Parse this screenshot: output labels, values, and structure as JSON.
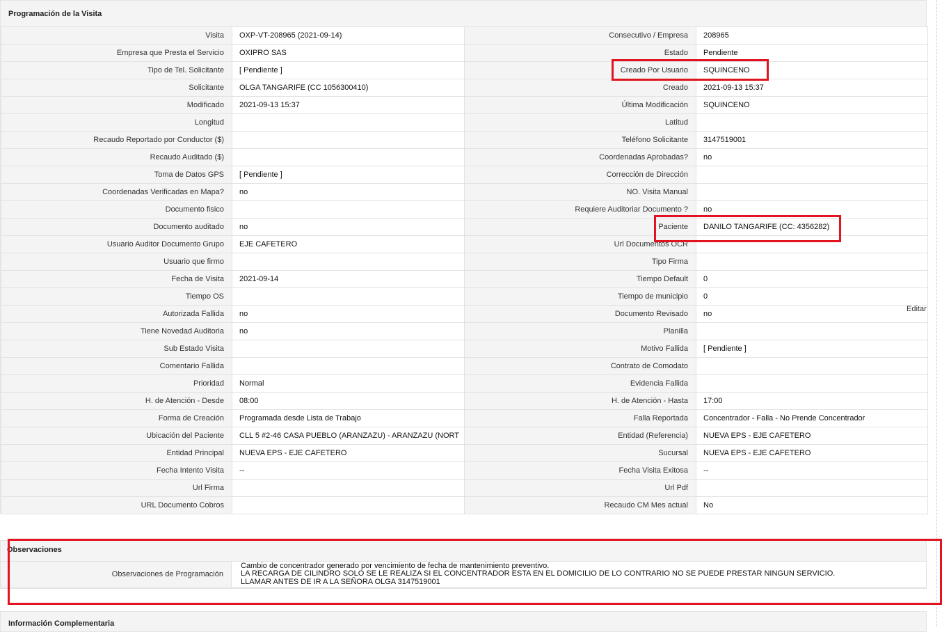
{
  "sections": {
    "programacion": "Programación de la Visita",
    "observaciones": "Observaciones",
    "complementaria": "Información Complementaria"
  },
  "rows": [
    {
      "l1": "Visita",
      "v1": "OXP-VT-208965 (2021-09-14)",
      "l2": "Consecutivo / Empresa",
      "v2": "208965"
    },
    {
      "l1": "Empresa que Presta el Servicio",
      "v1": "OXIPRO SAS",
      "l2": "Estado",
      "v2": "Pendiente"
    },
    {
      "l1": "Tipo de Tel. Solicitante",
      "v1": "[ Pendiente ]",
      "l2": "Creado Por Usuario",
      "v2": "SQUINCENO"
    },
    {
      "l1": "Solicitante",
      "v1": "OLGA TANGARIFE (CC 1056300410)",
      "l2": "Creado",
      "v2": "2021-09-13 15:37"
    },
    {
      "l1": "Modificado",
      "v1": "2021-09-13 15:37",
      "l2": "Última Modificación",
      "v2": " SQUINCENO"
    },
    {
      "l1": "Longitud",
      "v1": "",
      "l2": "Latitud",
      "v2": ""
    },
    {
      "l1": "Recaudo Reportado por Conductor ($)",
      "v1": "",
      "l2": "Teléfono Solicitante",
      "v2": "3147519001"
    },
    {
      "l1": "Recaudo Auditado ($)",
      "v1": "",
      "l2": "Coordenadas Aprobadas?",
      "v2": " no"
    },
    {
      "l1": "Toma de Datos GPS",
      "v1": "[ Pendiente ]",
      "l2": "Corrección de Dirección",
      "v2": ""
    },
    {
      "l1": "Coordenadas Verificadas en Mapa?",
      "v1": " no",
      "l2": "NO. Visita Manual",
      "v2": ""
    },
    {
      "l1": "Documento fisico",
      "v1": "",
      "l2": "Requiere Auditoriar Documento ?",
      "v2": " no"
    },
    {
      "l1": "Documento auditado",
      "v1": " no",
      "l2": "Paciente",
      "v2": "DANILO TANGARIFE (CC: 4356282)"
    },
    {
      "l1": "Usuario Auditor Documento Grupo",
      "v1": "EJE CAFETERO",
      "l2": "Url Documentos OCR",
      "v2": ""
    },
    {
      "l1": "Usuario que firmo",
      "v1": "",
      "l2": "Tipo Firma",
      "v2": ""
    },
    {
      "l1": "Fecha de Visita",
      "v1": " 2021-09-14",
      "l2": "Tiempo Default",
      "v2": "0"
    },
    {
      "l1": "Tiempo OS",
      "v1": "",
      "l2": "Tiempo de municipio",
      "v2": "0"
    },
    {
      "l1": "Autorizada Fallida",
      "v1": " no",
      "l2": "Documento Revisado",
      "v2": " no"
    },
    {
      "l1": "Tiene Novedad Auditoria",
      "v1": " no",
      "l2": "Planilla",
      "v2": ""
    },
    {
      "l1": "Sub Estado Visita",
      "v1": "",
      "l2": "Motivo Fallida",
      "v2": "[ Pendiente ]"
    },
    {
      "l1": "Comentario Fallida",
      "v1": "",
      "l2": "Contrato de Comodato",
      "v2": ""
    },
    {
      "l1": "Prioridad",
      "v1": "Normal",
      "l2": "Evidencia Fallida",
      "v2": ""
    },
    {
      "l1": "H. de Atención - Desde",
      "v1": "08:00",
      "l2": "H. de Atención - Hasta",
      "v2": "17:00"
    },
    {
      "l1": "Forma de Creación",
      "v1": "Programada desde Lista de Trabajo",
      "l2": "Falla Reportada",
      "v2": "Concentrador - Falla - No Prende Concentrador"
    },
    {
      "l1": "Ubicación del Paciente",
      "v1": "CLL 5 #2-46 CASA PUEBLO (ARANZAZU) - ARANZAZU (NORT",
      "l2": "Entidad (Referencia)",
      "v2": "NUEVA EPS - EJE CAFETERO"
    },
    {
      "l1": "Entidad Principal",
      "v1": "NUEVA EPS - EJE CAFETERO",
      "l2": "Sucursal",
      "v2": "NUEVA EPS - EJE CAFETERO"
    },
    {
      "l1": "Fecha Intento Visita",
      "v1": " --",
      "l2": "Fecha Visita Exitosa",
      "v2": " --"
    },
    {
      "l1": "Url Firma",
      "v1": "",
      "l2": "Url Pdf",
      "v2": ""
    },
    {
      "l1": "URL Documento Cobros",
      "v1": "",
      "l2": "Recaudo CM Mes actual",
      "v2": "No"
    }
  ],
  "editar": "Editar",
  "observaciones": {
    "label": "Observaciones de Programación",
    "lines": [
      " Cambio de concentrador generado por vencimiento de fecha de mantenimiento preventivo.",
      "LA RECARGA DE CILINDRO SOLO SE LE REALIZA SI EL CONCENTRADOR ESTA EN EL DOMICILIO DE LO CONTRARIO NO SE PUEDE PRESTAR NINGUN SERVICIO.",
      "LLAMAR ANTES DE IR A LA SEÑORA OLGA 3147519001"
    ]
  },
  "colors": {
    "highlight": "#e0131f",
    "label_bg": "#f4f4f4",
    "border": "#e2e2e2"
  }
}
